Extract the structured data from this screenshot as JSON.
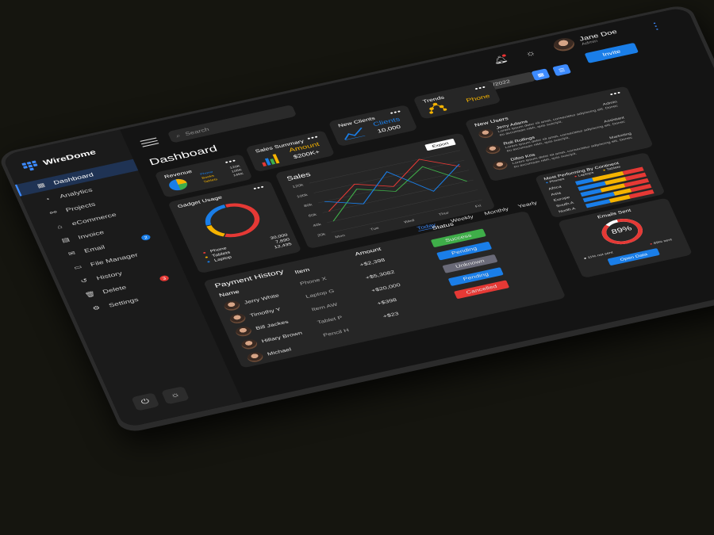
{
  "brand": {
    "name": "WireDome"
  },
  "sidebar": {
    "items": [
      {
        "label": "Dashboard",
        "icon": "grid-icon",
        "active": true
      },
      {
        "label": "Analytics",
        "icon": "chart-icon"
      },
      {
        "label": "Projects",
        "icon": "share-icon"
      },
      {
        "label": "eCommerce",
        "icon": "bag-icon"
      },
      {
        "label": "Invoice",
        "icon": "invoice-icon"
      },
      {
        "label": "Email",
        "icon": "mail-icon",
        "badge": "2",
        "badge_color": "#1a7ee8"
      },
      {
        "label": "File Manager",
        "icon": "folder-icon"
      },
      {
        "label": "History",
        "icon": "history-icon"
      },
      {
        "label": "Delete",
        "icon": "trash-icon",
        "badge": "3",
        "badge_color": "#e53935"
      },
      {
        "label": "Settings",
        "icon": "gear-icon"
      }
    ],
    "bottom_icons": [
      "power-icon",
      "sun-icon"
    ]
  },
  "topbar": {
    "search_placeholder": "Search",
    "page_title": "Dashboard",
    "user": {
      "name": "Jane Doe",
      "role": "Admin"
    },
    "date": "17/06/2022",
    "invite_label": "Invite"
  },
  "revenue": {
    "title": "Revenue",
    "rows": [
      {
        "label": "Phone",
        "value": "120K",
        "color": "#1a7ee8"
      },
      {
        "label": "Books",
        "value": "105K",
        "color": "#f5b301"
      },
      {
        "label": "Tablets",
        "value": "145K",
        "color": "#f5b301"
      }
    ]
  },
  "sales_summary": {
    "title": "Sales Summary",
    "label": "Amount",
    "value": "$200K+"
  },
  "new_clients": {
    "title": "New Clients",
    "label": "Clients",
    "value": "10,000"
  },
  "trends": {
    "title": "Trends",
    "label": "Phone"
  },
  "gadget_usage": {
    "title": "Gadget Usage",
    "items": [
      {
        "label": "Phone",
        "value": "30,000",
        "color": "#e53935"
      },
      {
        "label": "Tablets",
        "value": "7,890",
        "color": "#f5b301"
      },
      {
        "label": "Laptop",
        "value": "12,435",
        "color": "#1a7ee8"
      }
    ]
  },
  "sales": {
    "title": "Sales",
    "export_label": "Export"
  },
  "chart_data": {
    "type": "line",
    "title": "Sales",
    "categories": [
      "Mon",
      "Tue",
      "Wed",
      "Thur",
      "Fri"
    ],
    "y_ticks": [
      "120k",
      "100k",
      "80k",
      "60k",
      "40k",
      "20k"
    ],
    "ylim": [
      20,
      120
    ],
    "series": [
      {
        "color": "#e53935",
        "values": [
          60,
          100,
          80,
          120,
          90
        ]
      },
      {
        "color": "#3fae49",
        "values": [
          40,
          90,
          70,
          105,
          60
        ]
      },
      {
        "color": "#1a7ee8",
        "values": [
          80,
          60,
          110,
          55,
          95
        ]
      }
    ]
  },
  "new_users": {
    "title": "New Users",
    "users": [
      {
        "name": "Jerry Adams",
        "role": "Admin",
        "text": "Lorem ipsum dolor sit amet, consectetur adipiscing elit. Donec eu accumsan nibh, quis suscipit."
      },
      {
        "name": "Roli Rollings",
        "role": "Assistant",
        "text": "Lorem ipsum dolor sit amet, consectetur adipiscing elit. Donec eu accumsan nibh, quis suscipit."
      },
      {
        "name": "Difoo Kris",
        "role": "Marketing",
        "text": "Lorem ipsum dolor sit amet, consectetur adipiscing elit. Donec eu accumsan nibh, quis suscipit."
      }
    ]
  },
  "period_tabs": [
    "Today",
    "Weekly",
    "Monthly",
    "Yearly"
  ],
  "payment_history": {
    "title": "Payment History",
    "columns": {
      "name": "Name",
      "item": "Item",
      "amount": "Amount",
      "status": "Status"
    },
    "rows": [
      {
        "name": "Jerry White",
        "item": "Phone X",
        "amount": "+$2,398",
        "status": "Success",
        "status_color": "#3fae49"
      },
      {
        "name": "Timothy Y",
        "item": "Laptop G",
        "amount": "+$5,3082",
        "status": "Pending",
        "status_color": "#1a7ee8"
      },
      {
        "name": "Bill Jackes",
        "item": "Item AW",
        "amount": "+$20,000",
        "status": "Unknown",
        "status_color": "#6a6a78"
      },
      {
        "name": "Hillary Brown",
        "item": "Tablet P",
        "amount": "+$398",
        "status": "Pending",
        "status_color": "#1a7ee8"
      },
      {
        "name": "Michael",
        "item": "Pencil H",
        "amount": "+$23",
        "status": "Cancelled",
        "status_color": "#e53935"
      }
    ]
  },
  "continents": {
    "title": "Most Performing By Continent",
    "legend": [
      {
        "label": "Phones",
        "color": "#1a7ee8"
      },
      {
        "label": "Laptops",
        "color": "#e53935"
      },
      {
        "label": "Tablets",
        "color": "#f5b301"
      }
    ],
    "rows": [
      {
        "label": "Africa",
        "shares": [
          0.25,
          0.45,
          0.3
        ]
      },
      {
        "label": "Asia",
        "shares": [
          0.4,
          0.3,
          0.3
        ]
      },
      {
        "label": "Europe",
        "shares": [
          0.3,
          0.35,
          0.35
        ]
      },
      {
        "label": "South A",
        "shares": [
          0.45,
          0.25,
          0.3
        ]
      },
      {
        "label": "North A",
        "shares": [
          0.35,
          0.3,
          0.35
        ]
      }
    ]
  },
  "emails_sent": {
    "title": "Emails Sent",
    "percent": "89%",
    "fraction": 0.89,
    "legend_not_sent": "11% not sent",
    "legend_sent": "89% sent",
    "button_label": "Open Data"
  },
  "colors": {
    "accent": "#1a7ee8",
    "red": "#e53935",
    "yellow": "#f5b301",
    "green": "#3fae49"
  }
}
